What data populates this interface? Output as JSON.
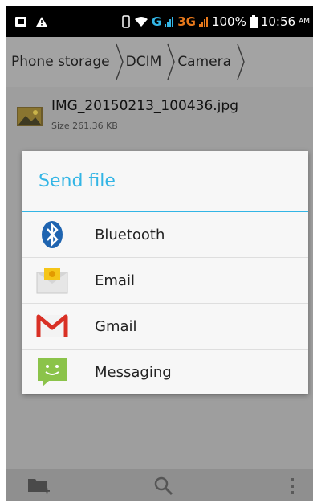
{
  "status_bar": {
    "network": "G",
    "network_3g": "3G",
    "battery": "100%",
    "time": "10:56",
    "ampm": "AM"
  },
  "breadcrumb": [
    "Phone storage",
    "DCIM",
    "Camera"
  ],
  "file": {
    "name": "IMG_20150213_100436.jpg",
    "size": "Size 261.36 KB"
  },
  "dialog": {
    "title": "Send file",
    "items": [
      {
        "label": "Bluetooth",
        "icon": "bluetooth-icon"
      },
      {
        "label": "Email",
        "icon": "email-icon"
      },
      {
        "label": "Gmail",
        "icon": "gmail-icon"
      },
      {
        "label": "Messaging",
        "icon": "messaging-icon"
      }
    ]
  },
  "toolbar": {
    "icons": [
      "new-folder-icon",
      "search-icon",
      "overflow-menu-icon"
    ]
  },
  "colors": {
    "accent": "#33b5e5",
    "dim_overlay": "#9c9c9c"
  }
}
